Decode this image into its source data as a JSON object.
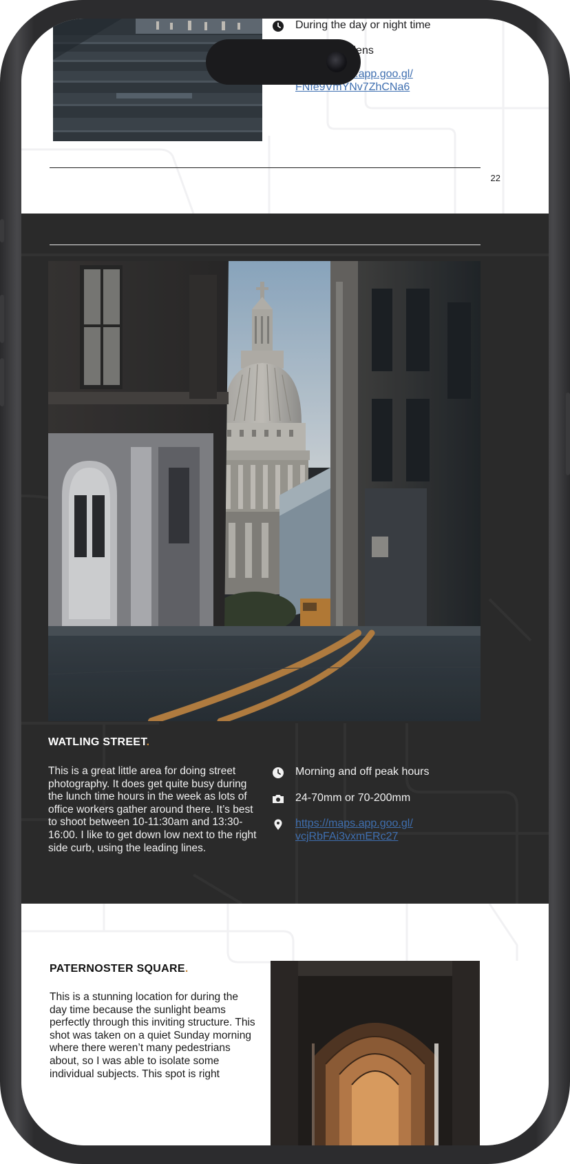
{
  "top_section": {
    "info": [
      {
        "icon": "clock-icon",
        "text": "During the day or night time"
      },
      {
        "icon": "camera-icon",
        "text": "Wide angle lens"
      },
      {
        "icon": "location-pin-icon",
        "link_line1": "https://maps.app.goo.gl/",
        "link_line2": "FNfe9VmYNv7ZhCNa6"
      }
    ],
    "page_number": "22"
  },
  "middle_section": {
    "title": "WATLING STREET",
    "title_dot": ".",
    "body": "This is a great little area for doing street photography. It does get quite busy during the lunch time hours in the week as lots of office workers gather around there. It’s best to shoot between 10-11:30am and 13:30-16:00. I like to get down low next to the right side curb, using the leading lines.",
    "info": [
      {
        "icon": "clock-icon",
        "text": "Morning and off peak hours"
      },
      {
        "icon": "camera-icon",
        "text": "24-70mm or 70-200mm"
      },
      {
        "icon": "location-pin-icon",
        "link_line1": "https://maps.app.goo.gl/",
        "link_line2": "vcjRbFAi3vxmERc27"
      }
    ]
  },
  "bottom_section": {
    "title": "PATERNOSTER SQUARE",
    "title_dot": ".",
    "body": "This is a stunning location for during the day time because the sunlight beams perfectly through this inviting structure. This shot was taken on a quiet Sunday morning where there weren’t many pedestrians about, so I was able to isolate some individual subjects. This spot is right"
  },
  "colors": {
    "frame": "#2c2c2e",
    "dark_section": "#2a2a2a",
    "link": "#3f6fb0",
    "accent_orange": "#c8873a"
  }
}
